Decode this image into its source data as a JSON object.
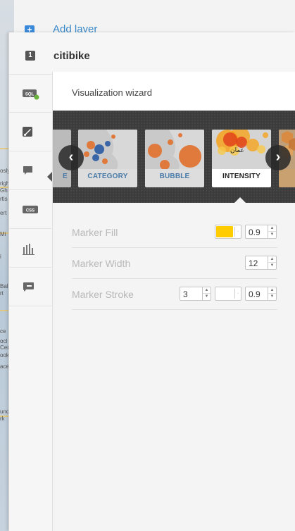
{
  "back_panel": {
    "add_layer_label": "Add layer"
  },
  "layer": {
    "number": "1",
    "name": "citibike"
  },
  "tools": [
    {
      "name": "sql",
      "label": "SQL"
    },
    {
      "name": "wizard",
      "label": ""
    },
    {
      "name": "infowindow",
      "label": ""
    },
    {
      "name": "css",
      "label": "CSS"
    },
    {
      "name": "legend",
      "label": ""
    },
    {
      "name": "filters",
      "label": ""
    }
  ],
  "wizard": {
    "title": "Visualization wizard",
    "partial_left_label": "E",
    "thumbnails": [
      {
        "label": "CATEGORY",
        "selected": false
      },
      {
        "label": "BUBBLE",
        "selected": false
      },
      {
        "label": "INTENSITY",
        "selected": true
      }
    ],
    "intensity_overlay_text": "عمان",
    "prev_glyph": "‹",
    "next_glyph": "›"
  },
  "properties": {
    "marker_fill": {
      "label": "Marker Fill",
      "color": "#ffcc00",
      "opacity": "0.9"
    },
    "marker_width": {
      "label": "Marker Width",
      "value": "12"
    },
    "marker_stroke": {
      "label": "Marker Stroke",
      "width": "3",
      "color": "#ffffff",
      "opacity": "0.9"
    }
  },
  "map_labels": [
    "osly",
    "right",
    "Gh",
    "rtis",
    "ert",
    "Mi",
    "i",
    "Bal",
    "rt",
    "ce",
    "ocl",
    "Cer",
    "ook",
    "ace",
    "und",
    "rk"
  ]
}
